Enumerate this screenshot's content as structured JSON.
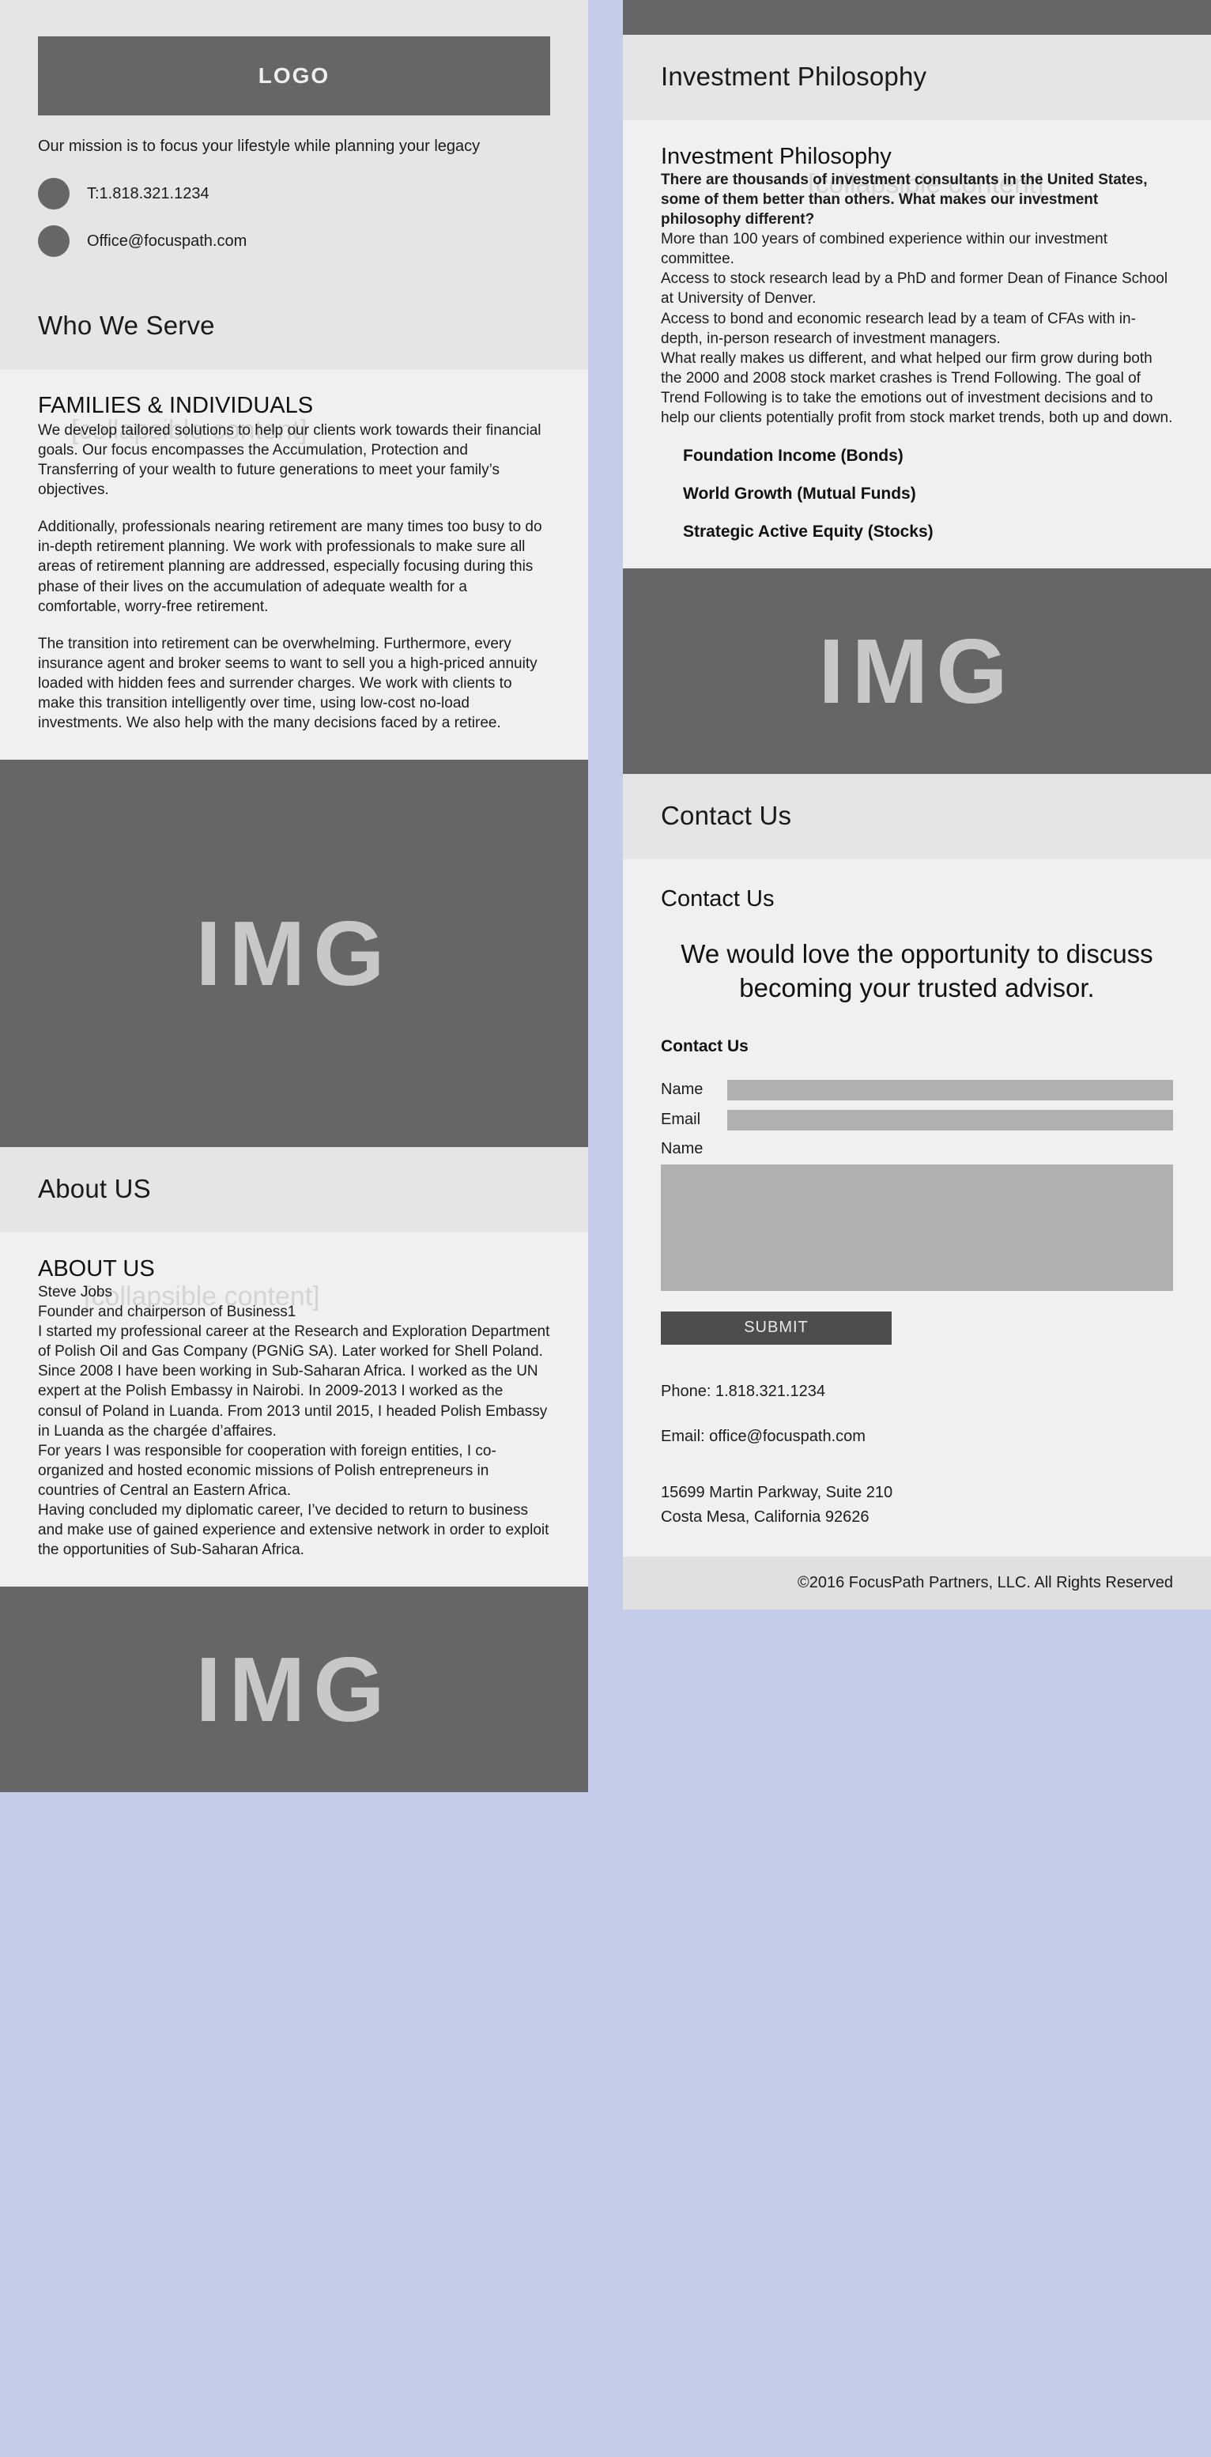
{
  "brand": {
    "logo_label": "LOGO",
    "mission": "Our mission is to focus your lifestyle while planning your legacy"
  },
  "contacts": [
    {
      "icon": "phone-icon",
      "text": "T:1.818.321.1234"
    },
    {
      "icon": "envelope-icon",
      "text": "Office@focuspath.com"
    }
  ],
  "watermark": "[collapsible content]",
  "image_placeholder": "IMG",
  "left": {
    "who_we_serve": {
      "bar_title": "Who We Serve",
      "panel_title": "FAMILIES & INDIVIDUALS",
      "paragraphs": [
        "We develop tailored solutions to help our clients work towards their financial goals. Our focus encompasses the Accumulation, Protection and Transferring of your wealth to future generations to meet your family’s objectives.",
        "Additionally, professionals nearing retirement are many times too busy to do in-depth retirement planning. We work with professionals to make sure all areas of retirement planning are addressed, especially focusing during this phase of their lives on the accumulation of adequate wealth for a comfortable, worry-free retirement.",
        "The transition into retirement can be overwhelming. Furthermore, every insurance agent and broker seems to want to sell you a high-priced annuity loaded with hidden fees and surrender charges. We work with clients to make this transition intelligently over time, using low-cost no-load investments. We also help with the many decisions faced by a retiree."
      ]
    },
    "about": {
      "bar_title": "About US",
      "panel_title": "ABOUT US",
      "lines": [
        "Steve Jobs",
        "Founder and chairperson of Business1",
        "I started my professional career at the Research and Exploration Department of Polish Oil and Gas Company (PGNiG SA). Later worked for Shell Poland.",
        "Since 2008 I have been working in Sub-Saharan Africa. I worked as the UN expert at the Polish Embassy in Nairobi. In 2009-2013 I worked as the consul of Poland in Luanda. From 2013 until 2015, I headed Polish Embassy in Luanda as the chargée d’affaires.",
        "For years I was responsible for cooperation with foreign entities, I co-organized and hosted economic missions of Polish entrepreneurs in countries of Central an Eastern Africa.",
        "Having concluded my diplomatic career, I’ve decided to return to business and make use of gained experience and extensive network in order to exploit the opportunities of Sub-Saharan Africa."
      ]
    }
  },
  "right": {
    "philosophy": {
      "bar_title": "Investment Philosophy",
      "panel_title": "Investment Philosophy",
      "lead": "There are thousands of investment consultants in the United States, some of them better than others. What makes our investment philosophy different?",
      "lines": [
        "More than 100 years of combined experience within our investment committee.",
        "Access to stock research lead by a PhD and former Dean of Finance School at University of Denver.",
        "Access to bond and economic research lead by a team of CFAs with in-depth, in-person research of investment managers.",
        "What really makes us different, and what helped our firm grow during both the 2000 and 2008 stock market crashes is Trend Following. The goal of Trend Following is to take the emotions out of investment decisions and to help our clients potentially profit from stock market trends, both up and down."
      ],
      "strategies": [
        "Foundation Income (Bonds)",
        "World Growth (Mutual Funds)",
        "Strategic Active Equity (Stocks)"
      ]
    },
    "contact": {
      "bar_title": "Contact Us",
      "panel_title": "Contact Us",
      "cta": "We would love the opportunity to discuss becoming your trusted advisor.",
      "form_title": "Contact Us",
      "fields": [
        {
          "label": "Name",
          "value": "",
          "placeholder": ""
        },
        {
          "label": "Email",
          "value": "",
          "placeholder": ""
        }
      ],
      "message_label": "Name",
      "message_value": "",
      "submit_label": "SUBMIT",
      "phone": "Phone: 1.818.321.1234",
      "email": "Email: office@focuspath.com",
      "address_line1": "15699 Martin Parkway, Suite 210",
      "address_line2": "Costa Mesa, California 92626"
    },
    "copyright": "©2016 FocusPath Partners, LLC. All Rights Reserved"
  }
}
